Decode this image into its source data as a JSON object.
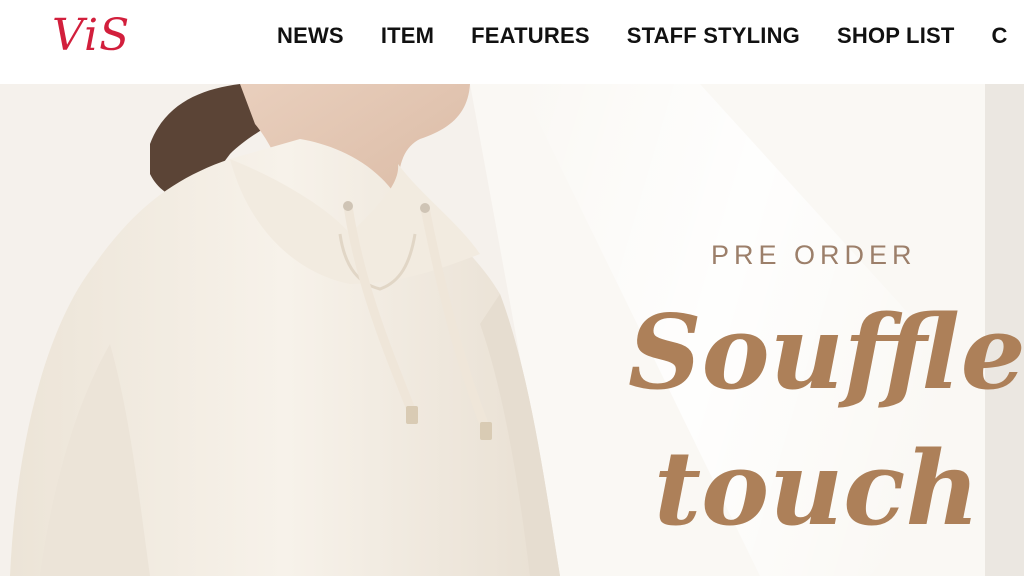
{
  "header": {
    "logo_text": "ViS",
    "brand_color": "#d21f3c",
    "nav": [
      {
        "label": "NEWS"
      },
      {
        "label": "ITEM"
      },
      {
        "label": "FEATURES"
      },
      {
        "label": "STAFF STYLING"
      },
      {
        "label": "SHOP LIST"
      },
      {
        "label": "C"
      }
    ]
  },
  "hero": {
    "pre_order": "PRE ORDER",
    "title_line1": "Souffle",
    "title_line2": "touch",
    "accent_color": "#ad8059",
    "image": "model-in-white-hoodie"
  }
}
